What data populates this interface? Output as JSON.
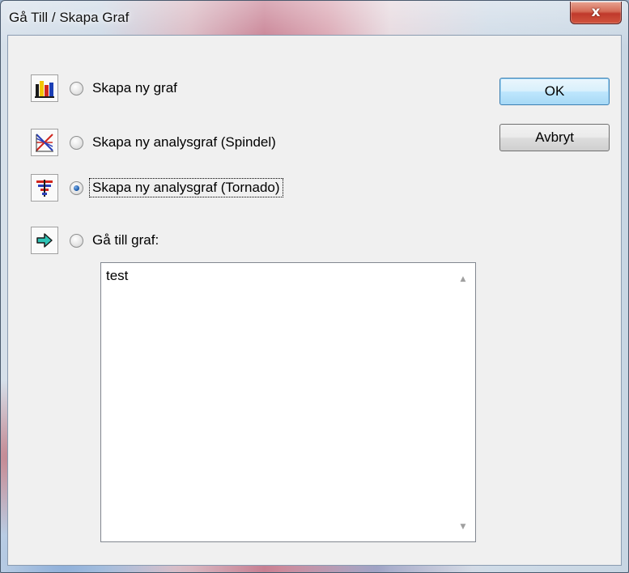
{
  "window": {
    "title": "Gå Till / Skapa Graf",
    "close_label": "x"
  },
  "options": [
    {
      "icon": "bar-chart-icon",
      "label": "Skapa ny graf",
      "selected": false
    },
    {
      "icon": "spider-chart-icon",
      "label": "Skapa ny analysgraf (Spindel)",
      "selected": false
    },
    {
      "icon": "tornado-chart-icon",
      "label": "Skapa ny analysgraf (Tornado)",
      "selected": true
    },
    {
      "icon": "arrow-right-icon",
      "label": "Gå till graf:",
      "selected": false
    }
  ],
  "buttons": {
    "ok": "OK",
    "cancel": "Avbryt"
  },
  "graph_list": {
    "items": [
      "test"
    ]
  },
  "scrollbar": {
    "up": "▲",
    "down": "▼"
  },
  "colors": {
    "radio_selected": "#1f5fb0",
    "default_button_border": "#3c7fb1",
    "close_button": "#c0392b"
  }
}
